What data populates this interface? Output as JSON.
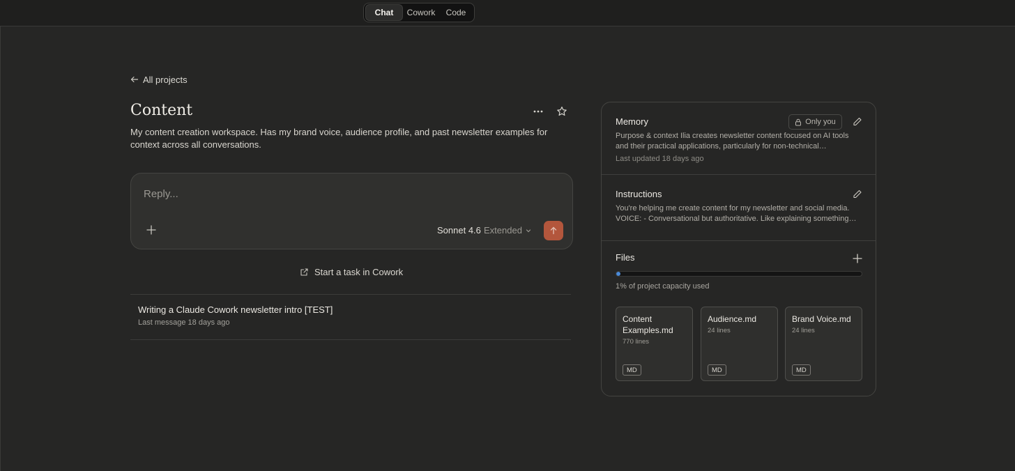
{
  "modes": [
    {
      "label": "Chat",
      "active": true
    },
    {
      "label": "Cowork",
      "active": false
    },
    {
      "label": "Code",
      "active": false
    }
  ],
  "nav": {
    "back_label": "All projects"
  },
  "project": {
    "title": "Content",
    "description": "My content creation workspace. Has my brand voice, audience profile, and past newsletter examples for context across all conversations."
  },
  "composer": {
    "placeholder": "Reply...",
    "model": "Sonnet 4.6",
    "mode": "Extended"
  },
  "cowork_link": "Start a task in Cowork",
  "chats": [
    {
      "title": "Writing a Claude Cowork newsletter intro [TEST]",
      "meta": "Last message 18 days ago"
    }
  ],
  "memory": {
    "title": "Memory",
    "visibility": "Only you",
    "text_line1": "Purpose & context Ilia creates newsletter content focused on AI tools",
    "text_line2": "and their practical applications, particularly for non-technical…",
    "updated": "Last updated 18 days ago"
  },
  "instructions": {
    "title": "Instructions",
    "text_line1": "You're helping me create content for my newsletter and social media.",
    "text_line2": "VOICE: - Conversational but authoritative. Like explaining something…"
  },
  "files": {
    "title": "Files",
    "capacity_percent": 1,
    "capacity_label": "1% of project capacity used",
    "items": [
      {
        "name": "Content Examples.md",
        "lines": "770 lines",
        "type": "MD"
      },
      {
        "name": "Audience.md",
        "lines": "24 lines",
        "type": "MD"
      },
      {
        "name": "Brand Voice.md",
        "lines": "24 lines",
        "type": "MD"
      }
    ]
  },
  "colors": {
    "accent": "#b3563c",
    "progress": "#4a8ad8",
    "background": "#262625"
  }
}
